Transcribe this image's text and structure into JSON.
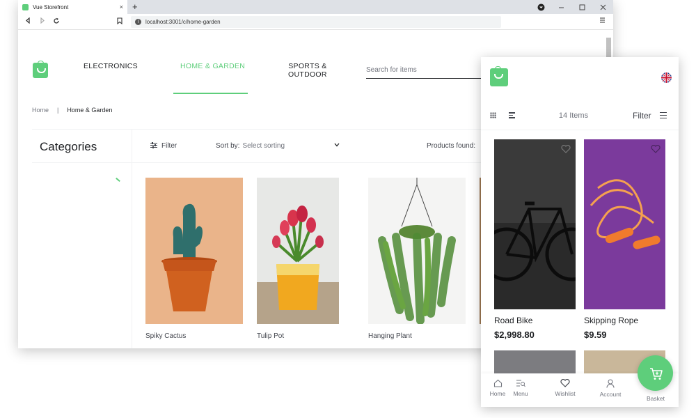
{
  "browser": {
    "tab_title": "Vue Storefront",
    "tab_close": "×",
    "new_tab": "+",
    "url": "localhost:3001/c/home-garden"
  },
  "site": {
    "nav": [
      "ELECTRONICS",
      "HOME & GARDEN",
      "SPORTS &\nOUTDOOR"
    ],
    "active_nav_index": 1,
    "search_placeholder": "Search for items",
    "breadcrumb": {
      "home": "Home",
      "separator": "|",
      "current": "Home & Garden"
    },
    "categories_title": "Categories",
    "filter_label": "Filter",
    "sort_label": "Sort by:",
    "sort_value": "Select sorting",
    "products_found": "Products found:",
    "products": [
      {
        "name": "Spiky Cactus"
      },
      {
        "name": "Tulip Pot"
      },
      {
        "name": "Hanging Plant"
      }
    ]
  },
  "mobile": {
    "items_count": "14 Items",
    "filter_label": "Filter",
    "products": [
      {
        "name": "Road Bike",
        "price": "$2,998.80"
      },
      {
        "name": "Skipping Rope",
        "price": "$9.59"
      }
    ],
    "bottom_nav": [
      "Home",
      "Menu",
      "Wishlist",
      "Account",
      "Basket"
    ]
  },
  "colors": {
    "brand": "#5ece7b",
    "text": "#1d1f22",
    "muted": "#72757e"
  },
  "icons": [
    "shopping-bag-logo-icon",
    "filter-icon",
    "chevron-down-icon",
    "heart-icon",
    "grid-icon",
    "list-icon",
    "uk-flag-icon",
    "home-icon",
    "menu-icon",
    "account-icon",
    "basket-icon"
  ]
}
